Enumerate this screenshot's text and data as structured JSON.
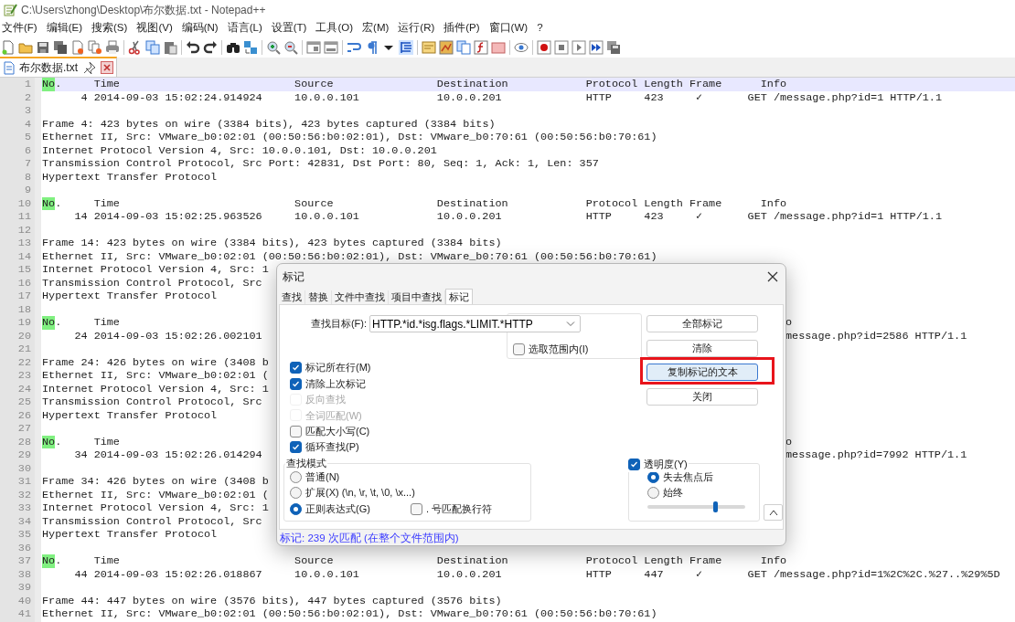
{
  "window": {
    "title": "C:\\Users\\zhong\\Desktop\\布尔数据.txt - Notepad++"
  },
  "menu": [
    "文件(F)",
    "编辑(E)",
    "搜索(S)",
    "视图(V)",
    "编码(N)",
    "语言(L)",
    "设置(T)",
    "工具(O)",
    "宏(M)",
    "运行(R)",
    "插件(P)",
    "窗口(W)",
    "?"
  ],
  "tab": {
    "label": "布尔数据.txt",
    "selected": true
  },
  "editor": {
    "lines": [
      {
        "n": "1",
        "kind": "header",
        "current": true,
        "mark": "No",
        "cells": [
          ".",
          "Time",
          "Source",
          "Destination",
          "Protocol",
          "Length",
          "Frame",
          "Info"
        ]
      },
      {
        "n": "2",
        "kind": "packet",
        "current": false,
        "cells": [
          "4",
          "2014-09-03 15:02:24.914924",
          "10.0.0.101",
          "10.0.0.201",
          "HTTP",
          "423",
          "✓",
          "GET /message.php?id=1 HTTP/1.1"
        ]
      },
      {
        "n": "3",
        "kind": "blank",
        "current": false
      },
      {
        "n": "4",
        "kind": "text",
        "current": false,
        "text": "Frame 4: 423 bytes on wire (3384 bits), 423 bytes captured (3384 bits)"
      },
      {
        "n": "5",
        "kind": "text",
        "current": false,
        "text": "Ethernet II, Src: VMware_b0:02:01 (00:50:56:b0:02:01), Dst: VMware_b0:70:61 (00:50:56:b0:70:61)"
      },
      {
        "n": "6",
        "kind": "text",
        "current": false,
        "text": "Internet Protocol Version 4, Src: 10.0.0.101, Dst: 10.0.0.201"
      },
      {
        "n": "7",
        "kind": "text",
        "current": false,
        "text": "Transmission Control Protocol, Src Port: 42831, Dst Port: 80, Seq: 1, Ack: 1, Len: 357"
      },
      {
        "n": "8",
        "kind": "text",
        "current": false,
        "text": "Hypertext Transfer Protocol"
      },
      {
        "n": "9",
        "kind": "blank",
        "current": false
      },
      {
        "n": "10",
        "kind": "header",
        "current": false,
        "mark": "No",
        "cells": [
          ".",
          "Time",
          "Source",
          "Destination",
          "Protocol",
          "Length",
          "Frame",
          "Info"
        ]
      },
      {
        "n": "11",
        "kind": "packet",
        "current": false,
        "cells": [
          "14",
          "2014-09-03 15:02:25.963526",
          "10.0.0.101",
          "10.0.0.201",
          "HTTP",
          "423",
          "✓",
          "GET /message.php?id=1 HTTP/1.1"
        ]
      },
      {
        "n": "12",
        "kind": "blank",
        "current": false
      },
      {
        "n": "13",
        "kind": "text",
        "current": false,
        "text": "Frame 14: 423 bytes on wire (3384 bits), 423 bytes captured (3384 bits)"
      },
      {
        "n": "14",
        "kind": "text",
        "current": false,
        "text": "Ethernet II, Src: VMware_b0:02:01 (00:50:56:b0:02:01), Dst: VMware_b0:70:61 (00:50:56:b0:70:61)"
      },
      {
        "n": "15",
        "kind": "text",
        "current": false,
        "text": "Internet Protocol Version 4, Src: 1"
      },
      {
        "n": "16",
        "kind": "text",
        "current": false,
        "text": "Transmission Control Protocol, Src"
      },
      {
        "n": "17",
        "kind": "text",
        "current": false,
        "text": "Hypertext Transfer Protocol"
      },
      {
        "n": "18",
        "kind": "blank",
        "current": false
      },
      {
        "n": "19",
        "kind": "header",
        "current": false,
        "mark": "No",
        "cells": [
          ".",
          "Time"
        ],
        "tail": "o"
      },
      {
        "n": "20",
        "kind": "packet",
        "current": false,
        "cells": [
          "24",
          "2014-09-03 15:02:26.002101"
        ],
        "tail": "message.php?id=2586 HTTP/1.1"
      },
      {
        "n": "21",
        "kind": "blank",
        "current": false
      },
      {
        "n": "22",
        "kind": "text",
        "current": false,
        "text": "Frame 24: 426 bytes on wire (3408 b"
      },
      {
        "n": "23",
        "kind": "text",
        "current": false,
        "text": "Ethernet II, Src: VMware_b0:02:01 ("
      },
      {
        "n": "24",
        "kind": "text",
        "current": false,
        "text": "Internet Protocol Version 4, Src: 1"
      },
      {
        "n": "25",
        "kind": "text",
        "current": false,
        "text": "Transmission Control Protocol, Src"
      },
      {
        "n": "26",
        "kind": "text",
        "current": false,
        "text": "Hypertext Transfer Protocol"
      },
      {
        "n": "27",
        "kind": "blank",
        "current": false
      },
      {
        "n": "28",
        "kind": "header",
        "current": false,
        "mark": "No",
        "cells": [
          ".",
          "Time"
        ],
        "tail": "o"
      },
      {
        "n": "29",
        "kind": "packet",
        "current": false,
        "cells": [
          "34",
          "2014-09-03 15:02:26.014294"
        ],
        "tail": "message.php?id=7992 HTTP/1.1"
      },
      {
        "n": "30",
        "kind": "blank",
        "current": false
      },
      {
        "n": "31",
        "kind": "text",
        "current": false,
        "text": "Frame 34: 426 bytes on wire (3408 b"
      },
      {
        "n": "32",
        "kind": "text",
        "current": false,
        "text": "Ethernet II, Src: VMware_b0:02:01 ("
      },
      {
        "n": "33",
        "kind": "text",
        "current": false,
        "text": "Internet Protocol Version 4, Src: 1"
      },
      {
        "n": "34",
        "kind": "text",
        "current": false,
        "text": "Transmission Control Protocol, Src"
      },
      {
        "n": "35",
        "kind": "text",
        "current": false,
        "text": "Hypertext Transfer Protocol"
      },
      {
        "n": "36",
        "kind": "blank",
        "current": false
      },
      {
        "n": "37",
        "kind": "header",
        "current": false,
        "mark": "No",
        "cells": [
          ".",
          "Time",
          "Source",
          "Destination",
          "Protocol",
          "Length",
          "Frame",
          "Info"
        ]
      },
      {
        "n": "38",
        "kind": "packet",
        "current": false,
        "cells": [
          "44",
          "2014-09-03 15:02:26.018867",
          "10.0.0.101",
          "10.0.0.201",
          "HTTP",
          "447",
          "✓",
          "GET /message.php?id=1%2C%2C.%27..%29%5D"
        ]
      },
      {
        "n": "39",
        "kind": "blank",
        "current": false
      },
      {
        "n": "40",
        "kind": "text",
        "current": false,
        "text": "Frame 44: 447 bytes on wire (3576 bits), 447 bytes captured (3576 bits)"
      },
      {
        "n": "41",
        "kind": "text",
        "current": false,
        "text": "Ethernet II, Src: VMware_b0:02:01 (00:50:56:b0:02:01), Dst: VMware_b0:70:61 (00:50:56:b0:70:61)"
      }
    ]
  },
  "dialog": {
    "title": "标记",
    "tabs": [
      {
        "label": "查找",
        "selected": false
      },
      {
        "label": "替换",
        "selected": false
      },
      {
        "label": "文件中查找",
        "selected": false
      },
      {
        "label": "项目中查找",
        "selected": false
      },
      {
        "label": "标记",
        "selected": true
      }
    ],
    "find_label": "查找目标(F):",
    "find_value": "HTTP.*id.*isg.flags.*LIMIT.*HTTP",
    "in_selection": {
      "label": "选取范围内(I)",
      "checked": false
    },
    "options": [
      {
        "label": "标记所在行(M)",
        "checked": true,
        "disabled": false
      },
      {
        "label": "清除上次标记",
        "checked": true,
        "disabled": false
      },
      {
        "label": "反向查找",
        "checked": false,
        "disabled": true
      },
      {
        "label": "全词匹配(W)",
        "checked": false,
        "disabled": true
      },
      {
        "label": "匹配大小写(C)",
        "checked": false,
        "disabled": false
      },
      {
        "label": "循环查找(P)",
        "checked": true,
        "disabled": false
      }
    ],
    "buttons": [
      {
        "label": "全部标记",
        "focused": false,
        "annotated": false
      },
      {
        "label": "清除",
        "focused": false,
        "annotated": false
      },
      {
        "label": "复制标记的文本",
        "focused": true,
        "annotated": true
      },
      {
        "label": "关闭",
        "focused": false,
        "annotated": false
      }
    ],
    "search_mode": {
      "title": "查找模式",
      "modes": [
        {
          "label": "普通(N)",
          "selected": false
        },
        {
          "label": "扩展(X) (\\n, \\r, \\t, \\0, \\x...)",
          "selected": false
        },
        {
          "label": "正则表达式(G)",
          "selected": true
        }
      ],
      "dot_newline": {
        "label": ". 号匹配换行符",
        "checked": false
      }
    },
    "transparency": {
      "label": "透明度(Y)",
      "checked": true,
      "modes": [
        {
          "label": "失去焦点后",
          "selected": true
        },
        {
          "label": "始终",
          "selected": false
        }
      ],
      "level": 0.7
    },
    "status": "标记: 239 次匹配 (在整个文件范围内)"
  }
}
